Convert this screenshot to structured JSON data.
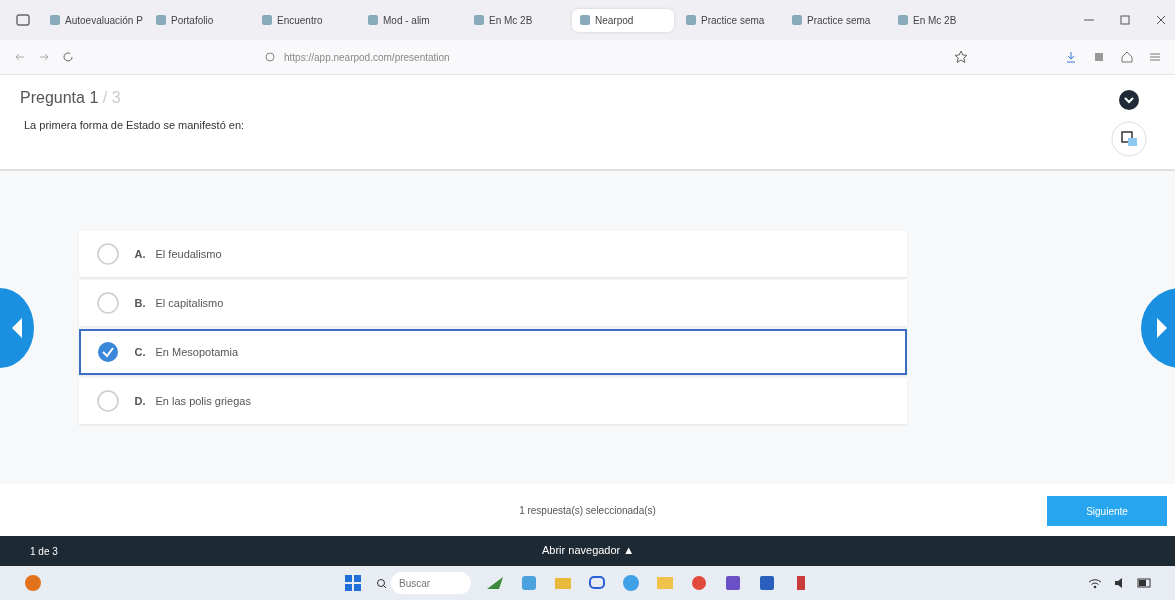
{
  "browser": {
    "tabs": [
      {
        "label": "Autoevaluación P",
        "selected": false
      },
      {
        "label": "Portafolio",
        "selected": false
      },
      {
        "label": "Encuentro",
        "selected": false
      },
      {
        "label": "Mod - alim",
        "selected": false
      },
      {
        "label": "En Mc 2B",
        "selected": false
      },
      {
        "label": "Nearpod",
        "selected": true
      },
      {
        "label": "Practice sema",
        "selected": false
      },
      {
        "label": "Practice sema",
        "selected": false
      },
      {
        "label": "En Mc 2B",
        "selected": false
      }
    ],
    "url": "https://app.nearpod.com/presentation"
  },
  "question": {
    "title": "Pregunta 1",
    "total": "/ 3",
    "text": "La primera forma de Estado se manifestó en:"
  },
  "options": [
    {
      "letter": "A.",
      "text": "El feudalismo",
      "selected": false
    },
    {
      "letter": "B.",
      "text": "El capitalismo",
      "selected": false
    },
    {
      "letter": "C.",
      "text": "En Mesopotamia",
      "selected": true
    },
    {
      "letter": "D.",
      "text": "En las polis griegas",
      "selected": false
    }
  ],
  "footer": {
    "status": "1 respuesta(s) seleccionada(s)",
    "button": "Siguiente"
  },
  "navigator_bar": {
    "counter": "1 de 3",
    "toggle": "Abrir navegador ▲"
  },
  "taskbar": {
    "search_placeholder": "Buscar"
  }
}
